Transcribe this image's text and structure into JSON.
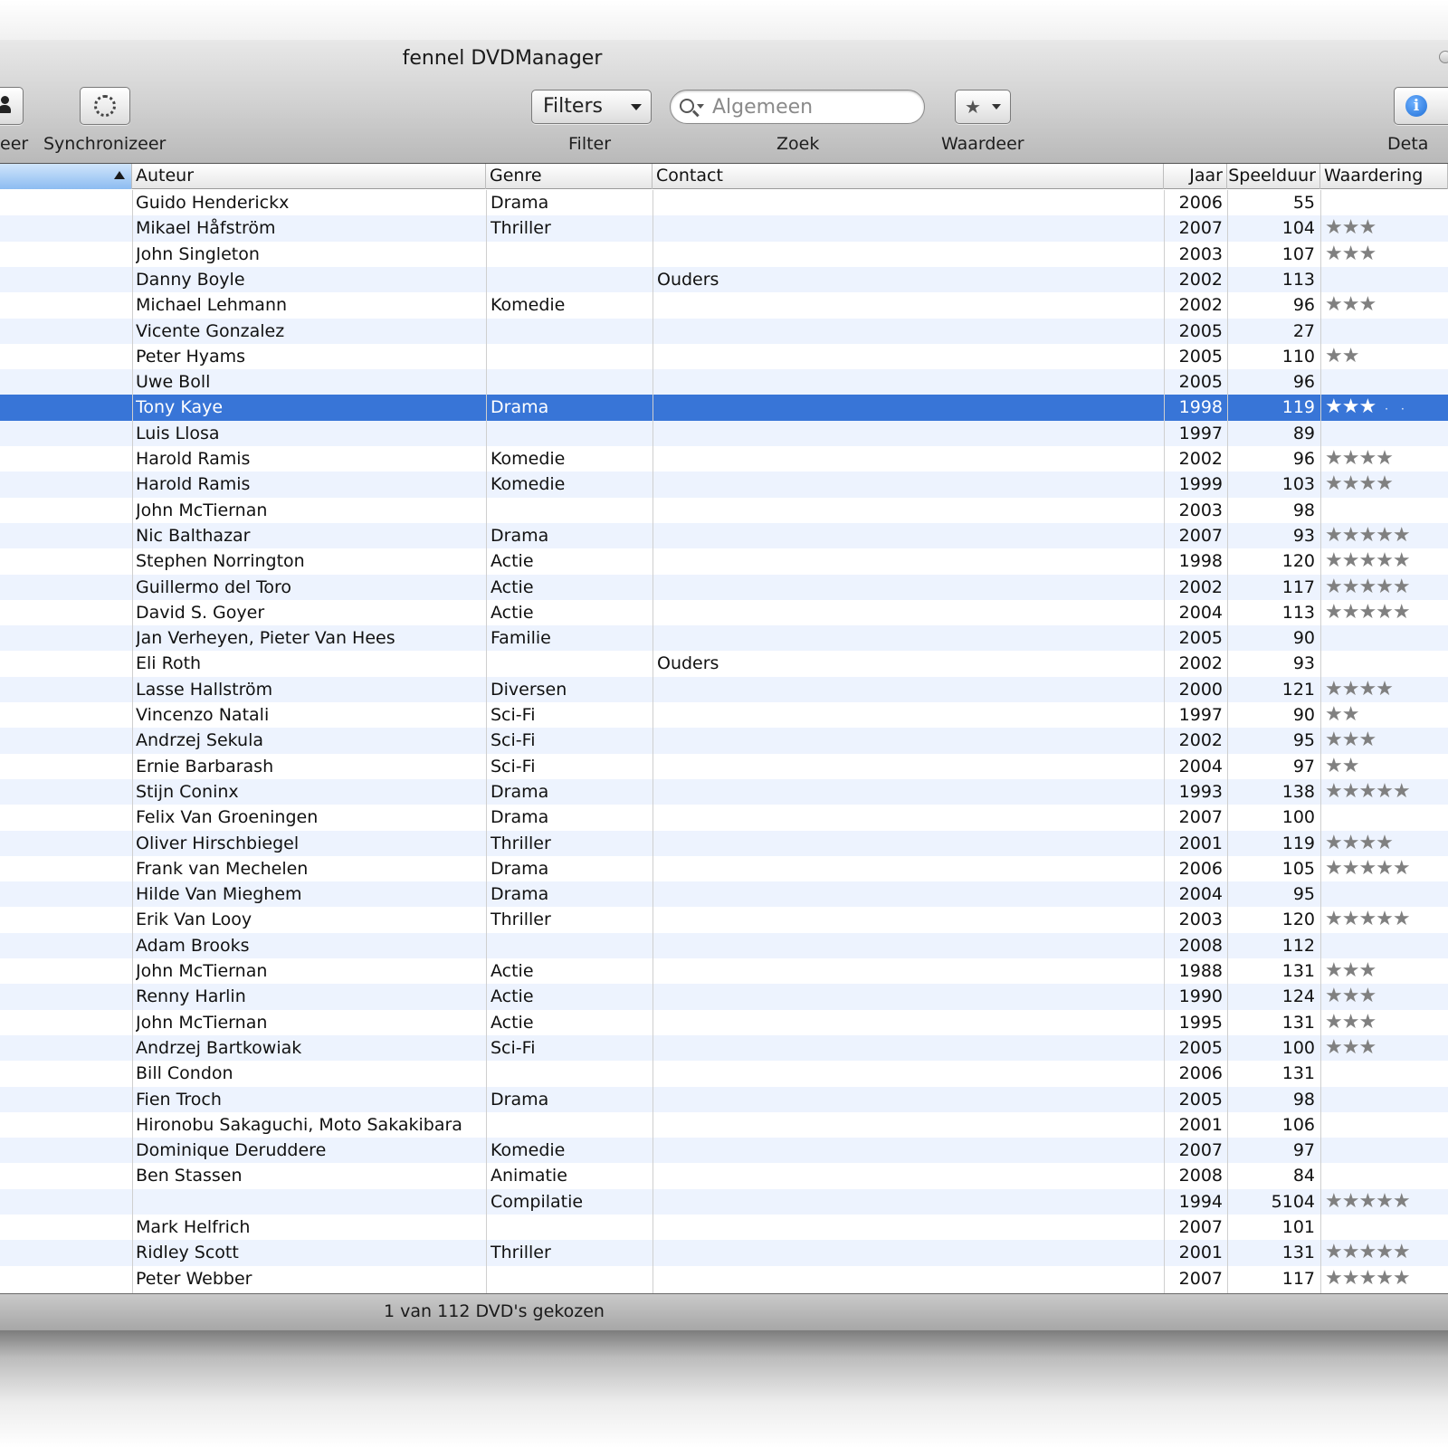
{
  "window": {
    "title": "fennel DVDManager",
    "status": "1 van 112 DVD's gekozen"
  },
  "toolbar": {
    "left_cut_label": "eer",
    "sync_label": "Synchronizeer",
    "filters_button": "Filters",
    "filter_label": "Filter",
    "search_placeholder": "Algemeen",
    "search_label": "Zoek",
    "rate_button": "★",
    "rate_label": "Waardeer",
    "details_label": "Deta",
    "details_icon": "info-icon"
  },
  "columns": {
    "auteur": "Auteur",
    "genre": "Genre",
    "contact": "Contact",
    "jaar": "Jaar",
    "speelduur": "Speelduur",
    "waardering": "Waardering"
  },
  "colors": {
    "selection": "#3875d7",
    "alternate_row": "#edf3fe",
    "star": "#808080"
  },
  "selected_index": 8,
  "rows": [
    {
      "auteur": "Guido Henderickx",
      "genre": "Drama",
      "contact": "",
      "jaar": "2006",
      "speelduur": "55",
      "waardering": 0
    },
    {
      "auteur": "Mikael Håfström",
      "genre": "Thriller",
      "contact": "",
      "jaar": "2007",
      "speelduur": "104",
      "waardering": 3
    },
    {
      "auteur": "John Singleton",
      "genre": "",
      "contact": "",
      "jaar": "2003",
      "speelduur": "107",
      "waardering": 3
    },
    {
      "auteur": "Danny Boyle",
      "genre": "",
      "contact": "Ouders",
      "jaar": "2002",
      "speelduur": "113",
      "waardering": 0
    },
    {
      "auteur": "Michael Lehmann",
      "genre": "Komedie",
      "contact": "",
      "jaar": "2002",
      "speelduur": "96",
      "waardering": 3
    },
    {
      "auteur": "Vicente Gonzalez",
      "genre": "",
      "contact": "",
      "jaar": "2005",
      "speelduur": "27",
      "waardering": 0
    },
    {
      "auteur": "Peter Hyams",
      "genre": "",
      "contact": "",
      "jaar": "2005",
      "speelduur": "110",
      "waardering": 2
    },
    {
      "auteur": "Uwe Boll",
      "genre": "",
      "contact": "",
      "jaar": "2005",
      "speelduur": "96",
      "waardering": 0
    },
    {
      "auteur": "Tony Kaye",
      "genre": "Drama",
      "contact": "",
      "jaar": "1998",
      "speelduur": "119",
      "waardering": 3
    },
    {
      "auteur": "Luis Llosa",
      "genre": "",
      "contact": "",
      "jaar": "1997",
      "speelduur": "89",
      "waardering": 0
    },
    {
      "auteur": "Harold Ramis",
      "genre": "Komedie",
      "contact": "",
      "jaar": "2002",
      "speelduur": "96",
      "waardering": 4
    },
    {
      "auteur": "Harold Ramis",
      "genre": "Komedie",
      "contact": "",
      "jaar": "1999",
      "speelduur": "103",
      "waardering": 4
    },
    {
      "auteur": "John McTiernan",
      "genre": "",
      "contact": "",
      "jaar": "2003",
      "speelduur": "98",
      "waardering": 0
    },
    {
      "auteur": "Nic Balthazar",
      "genre": "Drama",
      "contact": "",
      "jaar": "2007",
      "speelduur": "93",
      "waardering": 5
    },
    {
      "auteur": "Stephen Norrington",
      "genre": "Actie",
      "contact": "",
      "jaar": "1998",
      "speelduur": "120",
      "waardering": 5
    },
    {
      "auteur": "Guillermo del Toro",
      "genre": "Actie",
      "contact": "",
      "jaar": "2002",
      "speelduur": "117",
      "waardering": 5
    },
    {
      "auteur": "David S. Goyer",
      "genre": "Actie",
      "contact": "",
      "jaar": "2004",
      "speelduur": "113",
      "waardering": 5
    },
    {
      "auteur": "Jan Verheyen, Pieter Van Hees",
      "genre": "Familie",
      "contact": "",
      "jaar": "2005",
      "speelduur": "90",
      "waardering": 0
    },
    {
      "auteur": "Eli Roth",
      "genre": "",
      "contact": "Ouders",
      "jaar": "2002",
      "speelduur": "93",
      "waardering": 0
    },
    {
      "auteur": "Lasse Hallström",
      "genre": "Diversen",
      "contact": "",
      "jaar": "2000",
      "speelduur": "121",
      "waardering": 4
    },
    {
      "auteur": "Vincenzo Natali",
      "genre": "Sci-Fi",
      "contact": "",
      "jaar": "1997",
      "speelduur": "90",
      "waardering": 2
    },
    {
      "auteur": "Andrzej Sekula",
      "genre": "Sci-Fi",
      "contact": "",
      "jaar": "2002",
      "speelduur": "95",
      "waardering": 3
    },
    {
      "auteur": "Ernie Barbarash",
      "genre": "Sci-Fi",
      "contact": "",
      "jaar": "2004",
      "speelduur": "97",
      "waardering": 2
    },
    {
      "auteur": "Stijn Coninx",
      "genre": "Drama",
      "contact": "",
      "jaar": "1993",
      "speelduur": "138",
      "waardering": 5
    },
    {
      "auteur": "Felix Van Groeningen",
      "genre": "Drama",
      "contact": "",
      "jaar": "2007",
      "speelduur": "100",
      "waardering": 0
    },
    {
      "auteur": "Oliver Hirschbiegel",
      "genre": "Thriller",
      "contact": "",
      "jaar": "2001",
      "speelduur": "119",
      "waardering": 4
    },
    {
      "auteur": "Frank van Mechelen",
      "genre": "Drama",
      "contact": "",
      "jaar": "2006",
      "speelduur": "105",
      "waardering": 5
    },
    {
      "auteur": "Hilde Van Mieghem",
      "genre": "Drama",
      "contact": "",
      "jaar": "2004",
      "speelduur": "95",
      "waardering": 0
    },
    {
      "auteur": "Erik Van Looy",
      "genre": "Thriller",
      "contact": "",
      "jaar": "2003",
      "speelduur": "120",
      "waardering": 5
    },
    {
      "auteur": "Adam Brooks",
      "genre": "",
      "contact": "",
      "jaar": "2008",
      "speelduur": "112",
      "waardering": 0
    },
    {
      "auteur": "John McTiernan",
      "genre": "Actie",
      "contact": "",
      "jaar": "1988",
      "speelduur": "131",
      "waardering": 3
    },
    {
      "auteur": "Renny Harlin",
      "genre": "Actie",
      "contact": "",
      "jaar": "1990",
      "speelduur": "124",
      "waardering": 3
    },
    {
      "auteur": "John McTiernan",
      "genre": "Actie",
      "contact": "",
      "jaar": "1995",
      "speelduur": "131",
      "waardering": 3
    },
    {
      "auteur": "Andrzej Bartkowiak",
      "genre": "Sci-Fi",
      "contact": "",
      "jaar": "2005",
      "speelduur": "100",
      "waardering": 3
    },
    {
      "auteur": "Bill Condon",
      "genre": "",
      "contact": "",
      "jaar": "2006",
      "speelduur": "131",
      "waardering": 0
    },
    {
      "auteur": "Fien Troch",
      "genre": "Drama",
      "contact": "",
      "jaar": "2005",
      "speelduur": "98",
      "waardering": 0
    },
    {
      "auteur": "Hironobu Sakaguchi, Moto Sakakibara",
      "genre": "",
      "contact": "",
      "jaar": "2001",
      "speelduur": "106",
      "waardering": 0
    },
    {
      "auteur": "Dominique Deruddere",
      "genre": "Komedie",
      "contact": "",
      "jaar": "2007",
      "speelduur": "97",
      "waardering": 0
    },
    {
      "auteur": "Ben Stassen",
      "genre": "Animatie",
      "contact": "",
      "jaar": "2008",
      "speelduur": "84",
      "waardering": 0
    },
    {
      "auteur": "",
      "genre": "Compilatie",
      "contact": "",
      "jaar": "1994",
      "speelduur": "5104",
      "waardering": 5
    },
    {
      "auteur": "Mark Helfrich",
      "genre": "",
      "contact": "",
      "jaar": "2007",
      "speelduur": "101",
      "waardering": 0
    },
    {
      "auteur": "Ridley Scott",
      "genre": "Thriller",
      "contact": "",
      "jaar": "2001",
      "speelduur": "131",
      "waardering": 5
    },
    {
      "auteur": "Peter Webber",
      "genre": "",
      "contact": "",
      "jaar": "2007",
      "speelduur": "117",
      "waardering": 5
    }
  ]
}
